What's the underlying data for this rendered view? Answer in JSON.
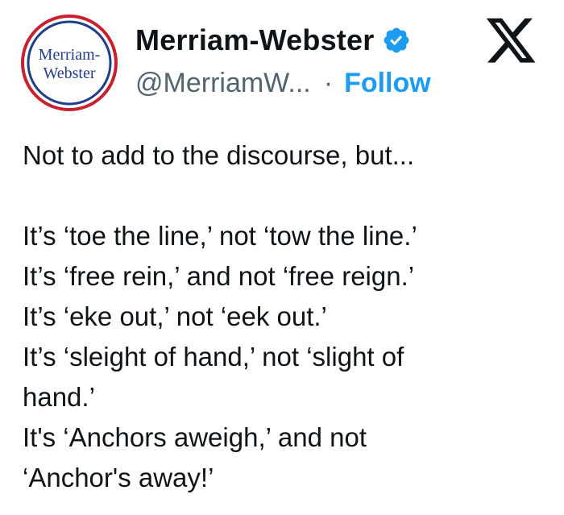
{
  "author": {
    "avatar_text_line1": "Merriam-",
    "avatar_text_line2": "Webster",
    "display_name": "Merriam-Webster",
    "handle": "@MerriamW...",
    "separator": "·",
    "follow_label": "Follow",
    "verified_icon": "verified-badge-icon"
  },
  "platform": {
    "logo_icon": "x-logo-icon"
  },
  "tweet": {
    "lines": [
      "Not to add to the discourse, but...",
      "",
      "It’s ‘toe the line,’ not ‘tow the line.’",
      "It’s ‘free rein,’ and not ‘free reign.’",
      "It’s ‘eke out,’ not ‘eek out.’",
      "It’s ‘sleight of hand,’ not ‘slight of",
      "hand.’",
      "It's ‘Anchors aweigh,’ and not",
      "‘Anchor's away!’"
    ]
  },
  "colors": {
    "follow_blue": "#1d9bf0",
    "verified_blue": "#1d9bf0",
    "avatar_red": "#c8202f",
    "avatar_navy": "#1f3f8c",
    "muted_gray": "#536471"
  }
}
